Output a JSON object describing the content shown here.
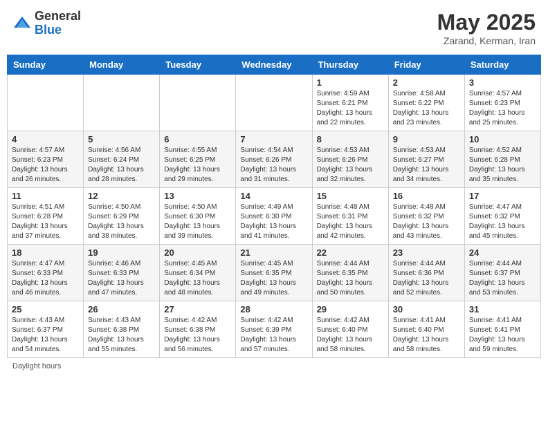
{
  "header": {
    "logo_general": "General",
    "logo_blue": "Blue",
    "month_title": "May 2025",
    "location": "Zarand, Kerman, Iran"
  },
  "footer": {
    "label": "Daylight hours"
  },
  "weekdays": [
    "Sunday",
    "Monday",
    "Tuesday",
    "Wednesday",
    "Thursday",
    "Friday",
    "Saturday"
  ],
  "weeks": [
    [
      {
        "day": "",
        "info": ""
      },
      {
        "day": "",
        "info": ""
      },
      {
        "day": "",
        "info": ""
      },
      {
        "day": "",
        "info": ""
      },
      {
        "day": "1",
        "info": "Sunrise: 4:59 AM\nSunset: 6:21 PM\nDaylight: 13 hours\nand 22 minutes."
      },
      {
        "day": "2",
        "info": "Sunrise: 4:58 AM\nSunset: 6:22 PM\nDaylight: 13 hours\nand 23 minutes."
      },
      {
        "day": "3",
        "info": "Sunrise: 4:57 AM\nSunset: 6:23 PM\nDaylight: 13 hours\nand 25 minutes."
      }
    ],
    [
      {
        "day": "4",
        "info": "Sunrise: 4:57 AM\nSunset: 6:23 PM\nDaylight: 13 hours\nand 26 minutes."
      },
      {
        "day": "5",
        "info": "Sunrise: 4:56 AM\nSunset: 6:24 PM\nDaylight: 13 hours\nand 28 minutes."
      },
      {
        "day": "6",
        "info": "Sunrise: 4:55 AM\nSunset: 6:25 PM\nDaylight: 13 hours\nand 29 minutes."
      },
      {
        "day": "7",
        "info": "Sunrise: 4:54 AM\nSunset: 6:26 PM\nDaylight: 13 hours\nand 31 minutes."
      },
      {
        "day": "8",
        "info": "Sunrise: 4:53 AM\nSunset: 6:26 PM\nDaylight: 13 hours\nand 32 minutes."
      },
      {
        "day": "9",
        "info": "Sunrise: 4:53 AM\nSunset: 6:27 PM\nDaylight: 13 hours\nand 34 minutes."
      },
      {
        "day": "10",
        "info": "Sunrise: 4:52 AM\nSunset: 6:28 PM\nDaylight: 13 hours\nand 35 minutes."
      }
    ],
    [
      {
        "day": "11",
        "info": "Sunrise: 4:51 AM\nSunset: 6:28 PM\nDaylight: 13 hours\nand 37 minutes."
      },
      {
        "day": "12",
        "info": "Sunrise: 4:50 AM\nSunset: 6:29 PM\nDaylight: 13 hours\nand 38 minutes."
      },
      {
        "day": "13",
        "info": "Sunrise: 4:50 AM\nSunset: 6:30 PM\nDaylight: 13 hours\nand 39 minutes."
      },
      {
        "day": "14",
        "info": "Sunrise: 4:49 AM\nSunset: 6:30 PM\nDaylight: 13 hours\nand 41 minutes."
      },
      {
        "day": "15",
        "info": "Sunrise: 4:48 AM\nSunset: 6:31 PM\nDaylight: 13 hours\nand 42 minutes."
      },
      {
        "day": "16",
        "info": "Sunrise: 4:48 AM\nSunset: 6:32 PM\nDaylight: 13 hours\nand 43 minutes."
      },
      {
        "day": "17",
        "info": "Sunrise: 4:47 AM\nSunset: 6:32 PM\nDaylight: 13 hours\nand 45 minutes."
      }
    ],
    [
      {
        "day": "18",
        "info": "Sunrise: 4:47 AM\nSunset: 6:33 PM\nDaylight: 13 hours\nand 46 minutes."
      },
      {
        "day": "19",
        "info": "Sunrise: 4:46 AM\nSunset: 6:33 PM\nDaylight: 13 hours\nand 47 minutes."
      },
      {
        "day": "20",
        "info": "Sunrise: 4:45 AM\nSunset: 6:34 PM\nDaylight: 13 hours\nand 48 minutes."
      },
      {
        "day": "21",
        "info": "Sunrise: 4:45 AM\nSunset: 6:35 PM\nDaylight: 13 hours\nand 49 minutes."
      },
      {
        "day": "22",
        "info": "Sunrise: 4:44 AM\nSunset: 6:35 PM\nDaylight: 13 hours\nand 50 minutes."
      },
      {
        "day": "23",
        "info": "Sunrise: 4:44 AM\nSunset: 6:36 PM\nDaylight: 13 hours\nand 52 minutes."
      },
      {
        "day": "24",
        "info": "Sunrise: 4:44 AM\nSunset: 6:37 PM\nDaylight: 13 hours\nand 53 minutes."
      }
    ],
    [
      {
        "day": "25",
        "info": "Sunrise: 4:43 AM\nSunset: 6:37 PM\nDaylight: 13 hours\nand 54 minutes."
      },
      {
        "day": "26",
        "info": "Sunrise: 4:43 AM\nSunset: 6:38 PM\nDaylight: 13 hours\nand 55 minutes."
      },
      {
        "day": "27",
        "info": "Sunrise: 4:42 AM\nSunset: 6:38 PM\nDaylight: 13 hours\nand 56 minutes."
      },
      {
        "day": "28",
        "info": "Sunrise: 4:42 AM\nSunset: 6:39 PM\nDaylight: 13 hours\nand 57 minutes."
      },
      {
        "day": "29",
        "info": "Sunrise: 4:42 AM\nSunset: 6:40 PM\nDaylight: 13 hours\nand 58 minutes."
      },
      {
        "day": "30",
        "info": "Sunrise: 4:41 AM\nSunset: 6:40 PM\nDaylight: 13 hours\nand 58 minutes."
      },
      {
        "day": "31",
        "info": "Sunrise: 4:41 AM\nSunset: 6:41 PM\nDaylight: 13 hours\nand 59 minutes."
      }
    ]
  ]
}
